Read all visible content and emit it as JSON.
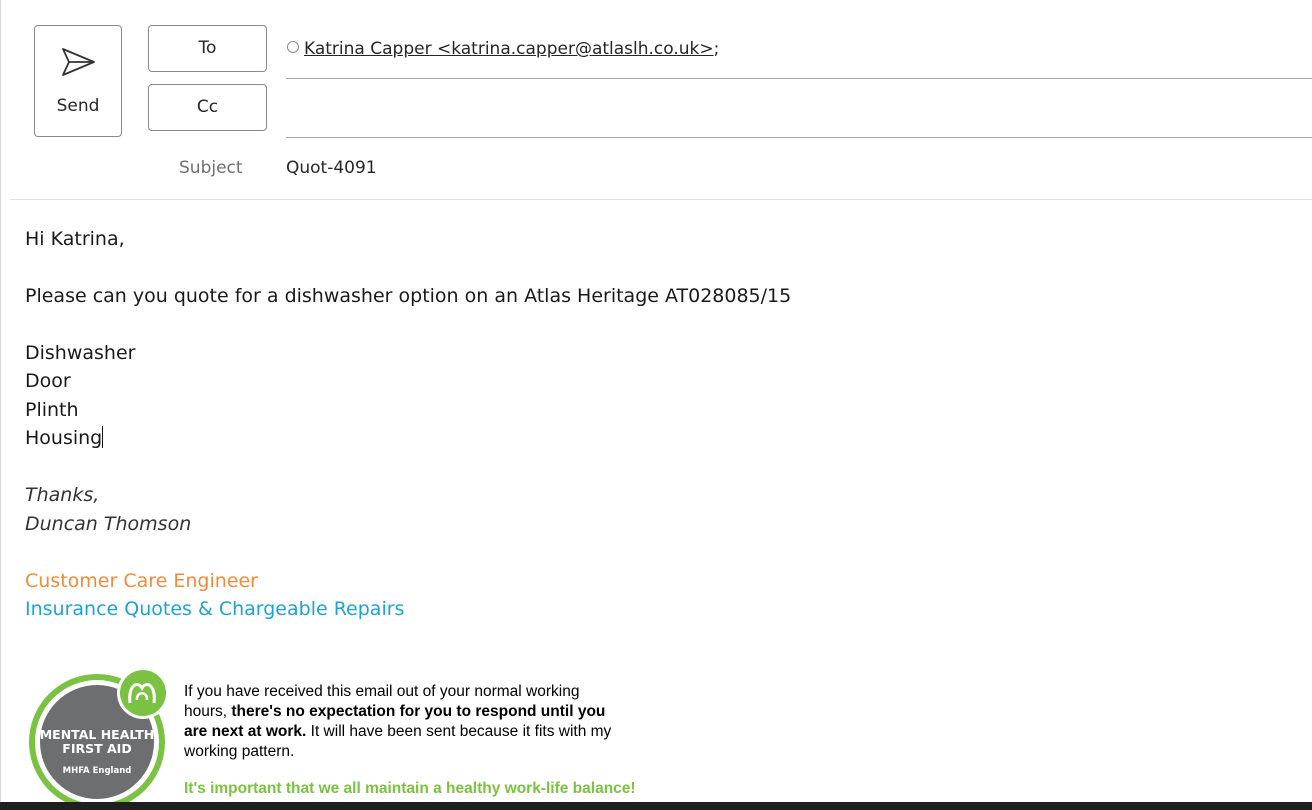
{
  "compose": {
    "send_label": "Send",
    "to_label": "To",
    "cc_label": "Cc",
    "to_recipient": "Katrina Capper <katrina.capper@atlaslh.co.uk>",
    "to_separator": ";",
    "cc_value": "",
    "subject_label": "Subject",
    "subject_value": "Quot-4091"
  },
  "message": {
    "greeting": "Hi Katrina,",
    "request": "Please can you quote for a dishwasher option on an Atlas Heritage AT028085/15",
    "items": [
      "Dishwasher",
      "Door",
      "Plinth",
      "Housing"
    ],
    "closing": "Thanks,",
    "sender_name": "Duncan Thomson",
    "sender_title": "Customer Care Engineer",
    "sender_department": "Insurance Quotes & Chargeable Repairs"
  },
  "signature": {
    "badge": {
      "line1": "MENTAL HEALTH",
      "line2": "FIRST AID",
      "line3": "MHFA England"
    },
    "disclaimer_part1": "If you have received this email out of your normal working hours, ",
    "disclaimer_bold": "there's no expectation for you to respond until you are next at work.",
    "disclaimer_part2": " It will have been sent because it fits with my working pattern.",
    "balance_note": "It's important that we all maintain a healthy work-life balance!"
  },
  "colors": {
    "title_orange": "#f08a3c",
    "department_blue": "#1ea2d8",
    "mhfa_green": "#7cc242",
    "mhfa_grey": "#6d6e70"
  }
}
